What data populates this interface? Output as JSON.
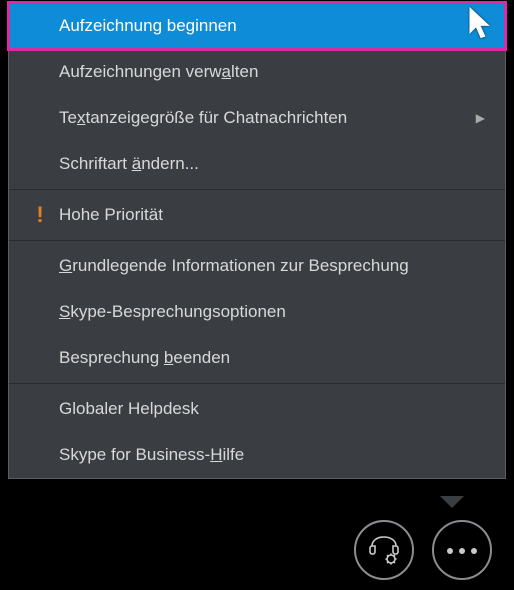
{
  "menu": {
    "items": [
      {
        "label": "Aufzeichnung beginnen",
        "highlighted": true,
        "hasSubmenu": false,
        "icon": null
      },
      {
        "label": "Aufzeichnungen verwalten",
        "underline_index": 19,
        "hasSubmenu": false
      },
      {
        "label": "Textanzeigegröße für Chatnachrichten",
        "underline_index": 2,
        "hasSubmenu": true
      },
      {
        "label": "Schriftart ändern...",
        "underline_index": 11,
        "hasSubmenu": false
      },
      {
        "divider": true
      },
      {
        "label": "Hohe Priorität",
        "icon": "priority",
        "hasSubmenu": false
      },
      {
        "divider": true
      },
      {
        "label": "Grundlegende Informationen zur Besprechung",
        "underline_index": 0,
        "hasSubmenu": false
      },
      {
        "label": "Skype-Besprechungsoptionen",
        "underline_index": 0,
        "hasSubmenu": false
      },
      {
        "label": "Besprechung beenden",
        "underline_index": 12,
        "hasSubmenu": false
      },
      {
        "divider": true
      },
      {
        "label": "Globaler Helpdesk",
        "hasSubmenu": false
      },
      {
        "label": "Skype for Business-Hilfe",
        "underline_index": 19,
        "hasSubmenu": false
      }
    ]
  },
  "buttons": {
    "phone_settings": "phone-settings",
    "more": "more-options"
  }
}
